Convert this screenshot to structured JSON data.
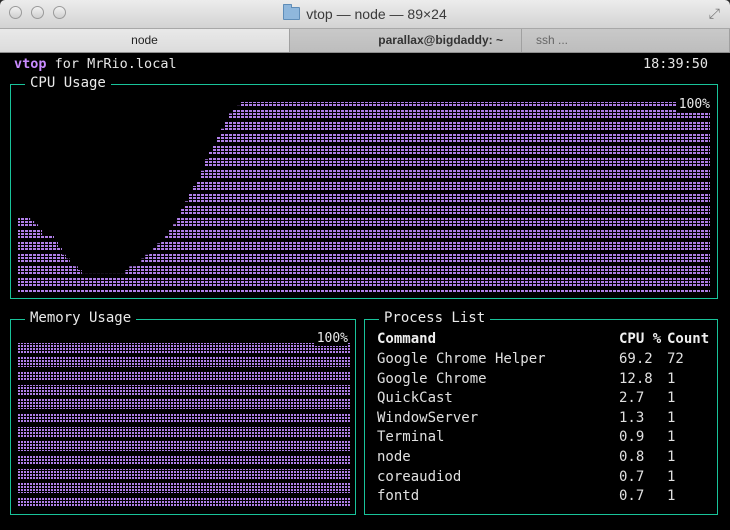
{
  "window": {
    "title": "vtop — node — 89×24",
    "tabs": [
      {
        "label": "node"
      },
      {
        "label": "parallax@bigdaddy: ~"
      },
      {
        "label": "ssh ..."
      }
    ]
  },
  "header": {
    "app_name": "vtop",
    "host_text": "for MrRio.local",
    "clock": "18:39:50"
  },
  "cpu_panel": {
    "title": "CPU Usage",
    "max_label": "100%",
    "dot_color": "#b07fe8"
  },
  "memory_panel": {
    "title": "Memory Usage",
    "max_label": "100%",
    "level_fraction": 1.0
  },
  "process_list": {
    "title": "Process List",
    "columns": [
      "Command",
      "CPU %",
      "Count"
    ],
    "rows": [
      {
        "command": "Google Chrome Helper",
        "cpu": "69.2",
        "count": "72"
      },
      {
        "command": "Google Chrome",
        "cpu": "12.8",
        "count": "1"
      },
      {
        "command": "QuickCast",
        "cpu": "2.7",
        "count": "1"
      },
      {
        "command": "WindowServer",
        "cpu": "1.3",
        "count": "1"
      },
      {
        "command": "Terminal",
        "cpu": "0.9",
        "count": "1"
      },
      {
        "command": "node",
        "cpu": "0.8",
        "count": "1"
      },
      {
        "command": "coreaudiod",
        "cpu": "0.7",
        "count": "1"
      },
      {
        "command": "fontd",
        "cpu": "0.7",
        "count": "1"
      }
    ]
  },
  "chart_data": {
    "type": "area",
    "title": "CPU Usage",
    "ylim": [
      0,
      100
    ],
    "values": [
      40,
      40,
      40,
      38,
      36,
      34,
      30,
      30,
      30,
      28,
      24,
      20,
      18,
      16,
      14,
      12,
      10,
      10,
      10,
      10,
      10,
      10,
      10,
      10,
      10,
      10,
      10,
      12,
      14,
      14,
      16,
      18,
      20,
      22,
      24,
      26,
      28,
      30,
      34,
      36,
      40,
      44,
      48,
      52,
      56,
      60,
      64,
      70,
      74,
      78,
      82,
      86,
      90,
      94,
      96,
      98,
      100,
      100,
      100,
      100,
      100,
      100,
      100,
      100,
      100,
      100,
      100,
      100,
      100,
      100,
      100,
      100,
      100,
      100,
      100,
      100,
      100,
      100,
      100,
      100,
      100,
      100,
      100,
      100,
      100,
      100,
      100,
      100,
      100,
      100,
      100,
      100,
      100,
      100,
      100,
      100,
      100,
      100,
      100,
      100,
      100,
      100,
      100,
      100,
      100,
      100,
      100,
      100,
      100,
      100,
      100,
      100,
      100,
      100,
      100,
      100,
      100,
      100,
      100,
      100,
      100,
      100,
      100,
      100,
      100,
      100,
      100,
      100,
      100,
      100,
      100,
      100,
      100,
      100,
      100,
      100,
      100,
      100,
      100,
      100,
      100,
      100,
      100,
      100,
      100,
      100,
      100,
      100,
      100,
      100,
      100,
      100,
      100,
      100,
      100,
      100,
      100,
      100,
      100,
      100,
      100,
      100,
      100,
      100,
      100,
      100,
      100,
      100,
      100,
      100,
      100,
      100,
      100,
      100
    ]
  }
}
